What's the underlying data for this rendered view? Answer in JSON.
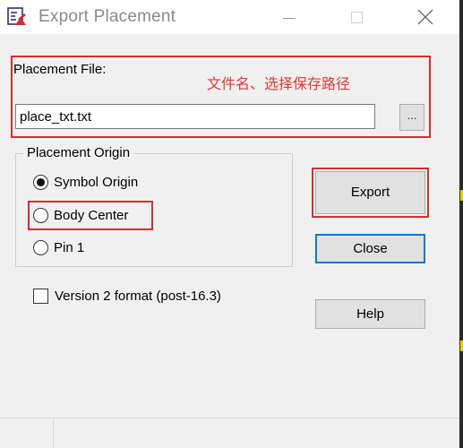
{
  "window": {
    "title": "Export Placement"
  },
  "placement_file": {
    "label": "Placement File:",
    "value": "place_txt.txt",
    "browse_label": "...",
    "annotation": "文件名、选择保存路径"
  },
  "placement_origin": {
    "title": "Placement Origin",
    "options": [
      {
        "label": "Symbol Origin",
        "checked": true
      },
      {
        "label": "Body Center",
        "checked": false
      },
      {
        "label": "Pin 1",
        "checked": false
      }
    ]
  },
  "version_checkbox": {
    "label": "Version 2 format (post-16.3)",
    "checked": false
  },
  "buttons": {
    "export": "Export",
    "close": "Close",
    "help": "Help"
  },
  "colors": {
    "highlight_box": "#d32f2f",
    "annotation": "#e53935",
    "default_button_border": "#0078d7"
  }
}
